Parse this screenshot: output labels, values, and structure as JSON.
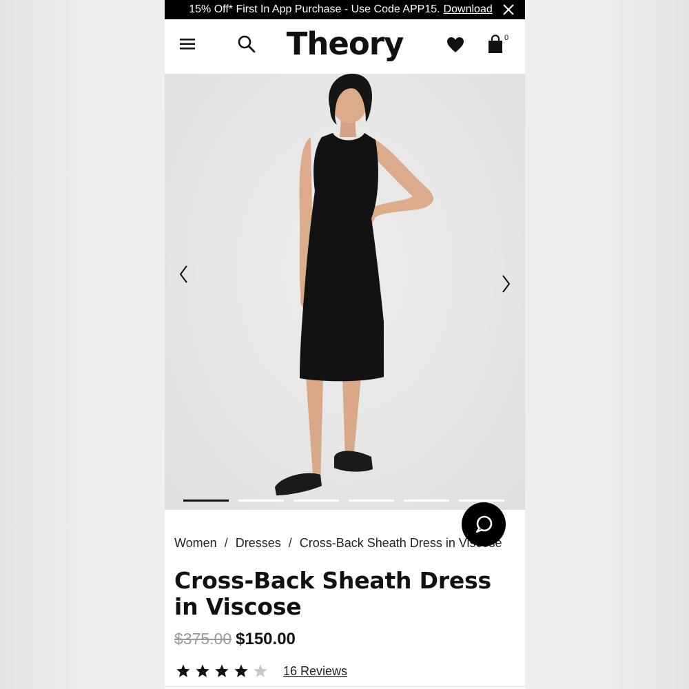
{
  "promo": {
    "text": "15% Off* First In App Purchase - Use Code APP15.",
    "link": "Download"
  },
  "header": {
    "logo": "Theory",
    "cart_count": "0"
  },
  "icons": {
    "menu": "hamburger-menu-icon",
    "search": "search-icon",
    "wishlist": "heart-icon",
    "cart": "shopping-bag-icon",
    "close": "close-icon",
    "prev": "chevron-left-icon",
    "next": "chevron-right-icon",
    "chat": "chat-icon"
  },
  "gallery": {
    "slide_count": 6,
    "active_slide": 1
  },
  "breadcrumb": {
    "items": [
      "Women",
      "Dresses",
      "Cross-Back Sheath Dress in Viscose"
    ],
    "separator": "/"
  },
  "product": {
    "title": "Cross-Back Sheath Dress in Viscose",
    "original_price": "$375.00",
    "sale_price": "$150.00",
    "rating": 4,
    "rating_max": 5,
    "reviews_label": "16 Reviews"
  },
  "colors": {
    "brand": "#000000",
    "text": "#111111",
    "strike_price": "#9a9a9a",
    "empty_star": "#c8c8c8"
  }
}
